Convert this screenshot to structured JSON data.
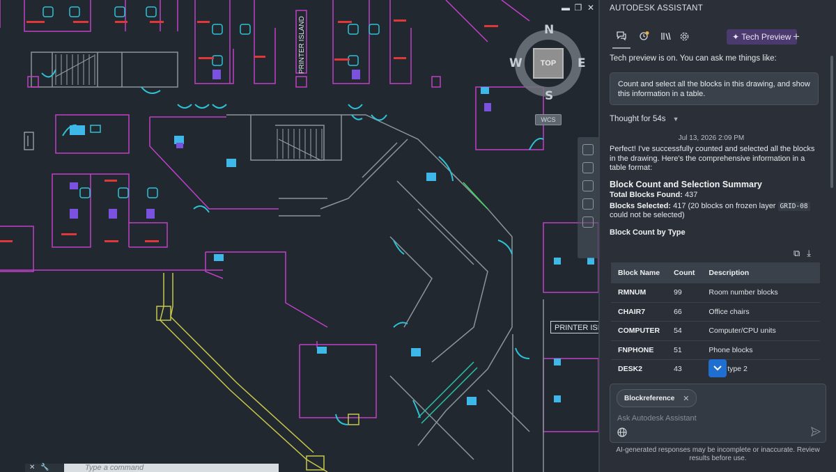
{
  "canvas": {
    "viewcube": {
      "north": "N",
      "south": "S",
      "east": "E",
      "west": "W",
      "face": "TOP",
      "wcs": "WCS"
    },
    "labels": {
      "printer_island_vertical": "PRINTER ISLAND",
      "printer_island_right": "PRINTER ISL"
    },
    "window_controls": {
      "minimize": "▬",
      "restore": "❐",
      "close": "✕"
    },
    "command_line": {
      "placeholder": "Type a command",
      "close": "✕",
      "wrench": "🔧"
    }
  },
  "panel": {
    "title": "AUTODESK ASSISTANT",
    "tech_preview_label": "Tech Preview",
    "plus": "+",
    "toolbar_icons": [
      "chat-icon",
      "history-icon",
      "library-icon",
      "settings-icon"
    ],
    "notice": "Tech preview is on. You can ask me things like:",
    "suggestion": "Count and select all the blocks in this drawing, and show this information in a table.",
    "thought": "Thought for 54s",
    "timestamp": "Jul 13, 2026 2:09 PM",
    "response": {
      "intro": "Perfect! I've successfully counted and selected all the blocks in the drawing. Here's the comprehensive information in a table format:",
      "heading": "Block Count and Selection Summary",
      "total_label": "Total Blocks Found:",
      "total_value": "437",
      "selected_label": "Blocks Selected:",
      "selected_value": "417 (20 blocks on frozen layer",
      "layer": "GRID-08",
      "selected_tail": "could not be selected)",
      "by_type": "Block Count by Type"
    },
    "table": {
      "headers": [
        "Block Name",
        "Count",
        "Description"
      ],
      "rows": [
        {
          "name": "RMNUM",
          "count": "99",
          "desc": "Room number blocks"
        },
        {
          "name": "CHAIR7",
          "count": "66",
          "desc": "Office chairs"
        },
        {
          "name": "COMPUTER",
          "count": "54",
          "desc": "Computer/CPU units"
        },
        {
          "name": "FNPHONE",
          "count": "51",
          "desc": "Phone blocks"
        },
        {
          "name": "DESK2",
          "count": "43",
          "desc": "Desk type 2"
        }
      ]
    },
    "input": {
      "chip": "Blockreference",
      "chip_close": "✕",
      "placeholder": "Ask Autodesk Assistant"
    },
    "disclaimer": "AI-generated responses may be incomplete or inaccurate. Review results before use."
  }
}
